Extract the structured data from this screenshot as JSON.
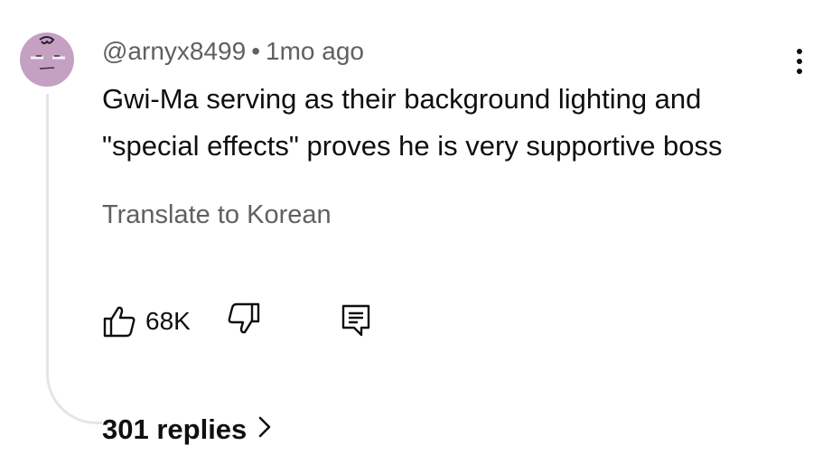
{
  "comment": {
    "author": "@arnyx8499",
    "separator": "•",
    "time": "1mo ago",
    "text_lines": [
      "Gwi-Ma serving as their background lighting and",
      "\"special effects\" proves he is very supportive boss"
    ],
    "translate_label": "Translate to Korean",
    "like_count": "68K",
    "replies_label": "301 replies"
  },
  "colors": {
    "text_primary": "#0f0f0f",
    "text_secondary": "#606060",
    "avatar_bg": "#c4a1c2",
    "thread_line": "#e5e5e5"
  },
  "icons": {
    "more": "vertical-dots-icon",
    "like": "thumbs-up-icon",
    "dislike": "thumbs-down-icon",
    "reply": "comment-reply-icon",
    "replies": "chevron-right-icon"
  }
}
